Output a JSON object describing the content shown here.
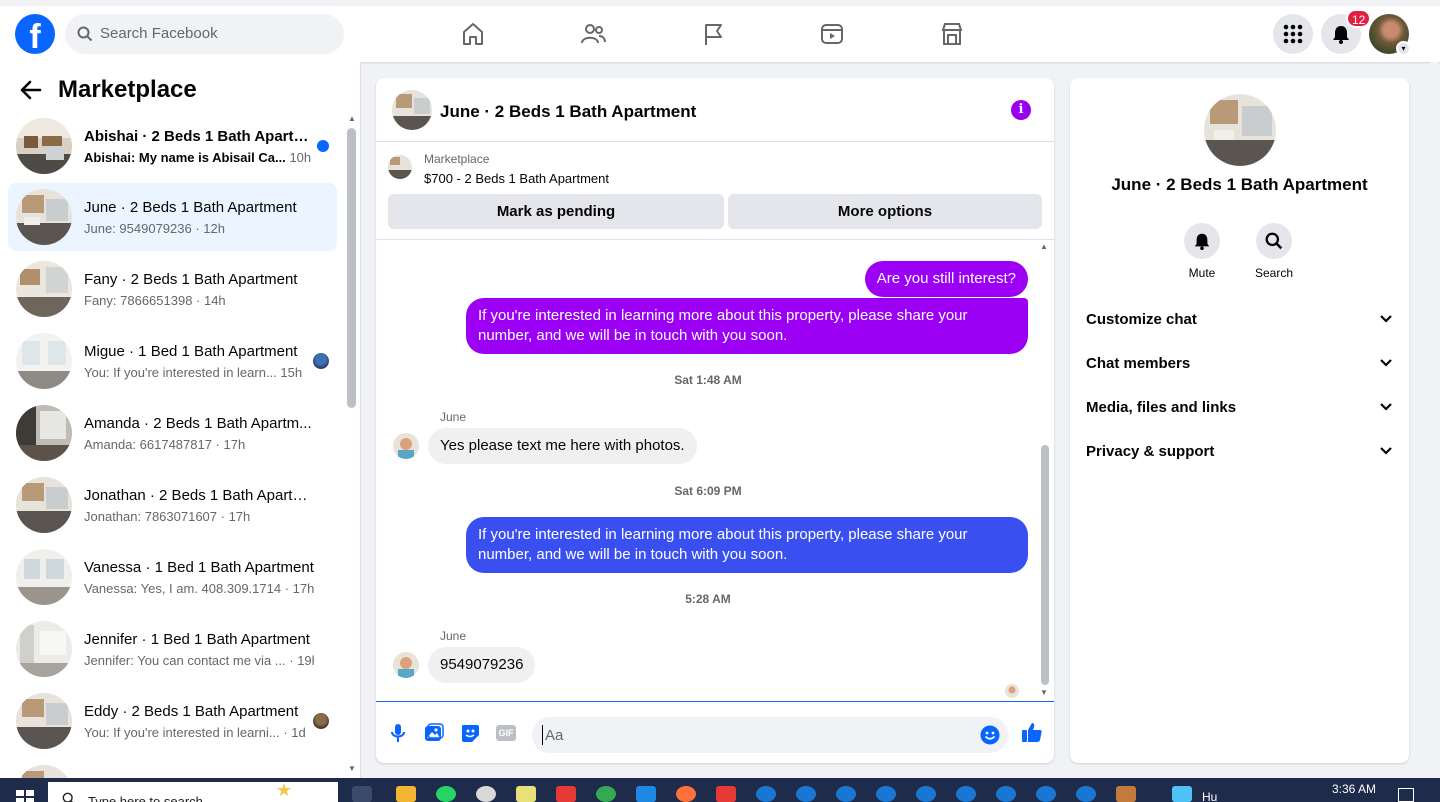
{
  "topbar": {
    "logo": "f",
    "search_placeholder": "Search Facebook",
    "nav_icons": [
      "home-icon",
      "friends-icon",
      "pages-flag-icon",
      "video-icon",
      "marketplace-icon"
    ],
    "notification_count": "12"
  },
  "sidebar": {
    "title": "Marketplace",
    "conversations": [
      {
        "name": "Abishai · 2 Beds 1 Bath Apartm...",
        "preview": "Abishai: My name is Abisail Ca...",
        "time": "10h",
        "unread": true
      },
      {
        "name": "June · 2 Beds 1 Bath Apartment",
        "preview": "June: 9549079236 · 12h",
        "active": true
      },
      {
        "name": "Fany · 2 Beds 1 Bath Apartment",
        "preview": "Fany: 7866651398 · 14h"
      },
      {
        "name": "Migue · 1 Bed 1 Bath Apartment",
        "preview": "You: If you're interested in learn...",
        "time": "15h"
      },
      {
        "name": "Amanda · 2 Beds 1 Bath Apartm...",
        "preview": "Amanda: 6617487817 · 17h"
      },
      {
        "name": "Jonathan · 2 Beds 1 Bath Apartm...",
        "preview": "Jonathan: 7863071607 · 17h"
      },
      {
        "name": "Vanessa · 1 Bed 1 Bath Apartment",
        "preview": "Vanessa: Yes, I am. 408.309.1714 · 17h"
      },
      {
        "name": "Jennifer · 1 Bed 1 Bath Apartment",
        "preview": "Jennifer: You can contact me via ...",
        "time": "· 19h"
      },
      {
        "name": "Eddy · 2 Beds 1 Bath Apartment",
        "preview": "You: If you're interested in learni...",
        "time": "· 1d"
      }
    ]
  },
  "chat": {
    "title": "June · 2 Beds 1 Bath Apartment",
    "listing_source": "Marketplace",
    "listing_title": "$700 - 2 Beds 1 Bath Apartment",
    "mark_pending_label": "Mark as pending",
    "more_options_label": "More options",
    "messages": [
      {
        "type": "out",
        "text": "Are you still interest?"
      },
      {
        "type": "out",
        "text": "If you're interested in learning more about this property, please share your number, and we will be in touch with you soon."
      },
      {
        "type": "time",
        "text": "Sat 1:48 AM"
      },
      {
        "type": "in",
        "sender": "June",
        "text": "Yes please text me here with photos."
      },
      {
        "type": "time",
        "text": "Sat 6:09 PM"
      },
      {
        "type": "out",
        "text": "If you're interested in learning more about this property, please share your number, and we will be in touch with you soon."
      },
      {
        "type": "time",
        "text": "5:28 AM"
      },
      {
        "type": "in",
        "sender": "June",
        "text": "9549079236"
      }
    ],
    "composer_placeholder": "Aa",
    "composer_icons": [
      "microphone-icon",
      "photo-icon",
      "sticker-icon",
      "gif-icon",
      "emoji-icon",
      "like-icon"
    ],
    "gif_label": "GIF"
  },
  "rpanel": {
    "title": "June · 2 Beds 1 Bath Apartment",
    "mute_label": "Mute",
    "search_label": "Search",
    "rows": [
      "Customize chat",
      "Chat members",
      "Media, files and links",
      "Privacy & support"
    ]
  },
  "taskbar": {
    "search_placeholder": "Type here to search",
    "time": "3:36 AM",
    "weather": "Hu"
  },
  "colors": {
    "brand_blue": "#0866ff",
    "purple_bubble": "#9b00f5",
    "blue_bubble": "#3a4ff0",
    "info_purple": "#9900ef"
  }
}
